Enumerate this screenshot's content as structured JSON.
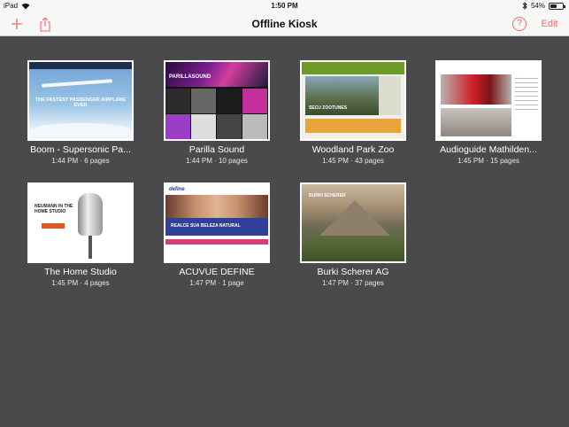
{
  "status_bar": {
    "device": "iPad",
    "time": "1:50 PM",
    "battery": "54%",
    "battery_level": 0.54
  },
  "nav": {
    "title": "Offline Kiosk",
    "edit_label": "Edit",
    "help_label": "?"
  },
  "colors": {
    "accent": "#f26b6b",
    "background": "#4a4a4d",
    "bar": "#f7f7f7"
  },
  "tiles": [
    {
      "title": "Boom - Supersonic Pa...",
      "meta": "1:44 PM · 6 pages",
      "thumb_text": "THE FASTEST PASSENGER AIRPLANE EVER"
    },
    {
      "title": "Parilla Sound",
      "meta": "1:44 PM · 10 pages",
      "thumb_text": "PARILLASOUND"
    },
    {
      "title": "Woodland Park Zoo",
      "meta": "1:45 PM · 43 pages",
      "thumb_text": "SECU ZOOTUNES"
    },
    {
      "title": "Audioguide Mathilden...",
      "meta": "1:45 PM · 15 pages"
    },
    {
      "title": "The Home Studio",
      "meta": "1:45 PM · 4 pages",
      "thumb_text": "NEUMANN IN THE HOME STUDIO"
    },
    {
      "title": "ACUVUE DEFINE",
      "meta": "1:47 PM · 1 page",
      "thumb_text": "REALCE SUA BELEZA NATURAL",
      "thumb_logo": "define"
    },
    {
      "title": "Burki Scherer AG",
      "meta": "1:47 PM · 37 pages",
      "thumb_text": "BURKI SCHERER"
    }
  ]
}
